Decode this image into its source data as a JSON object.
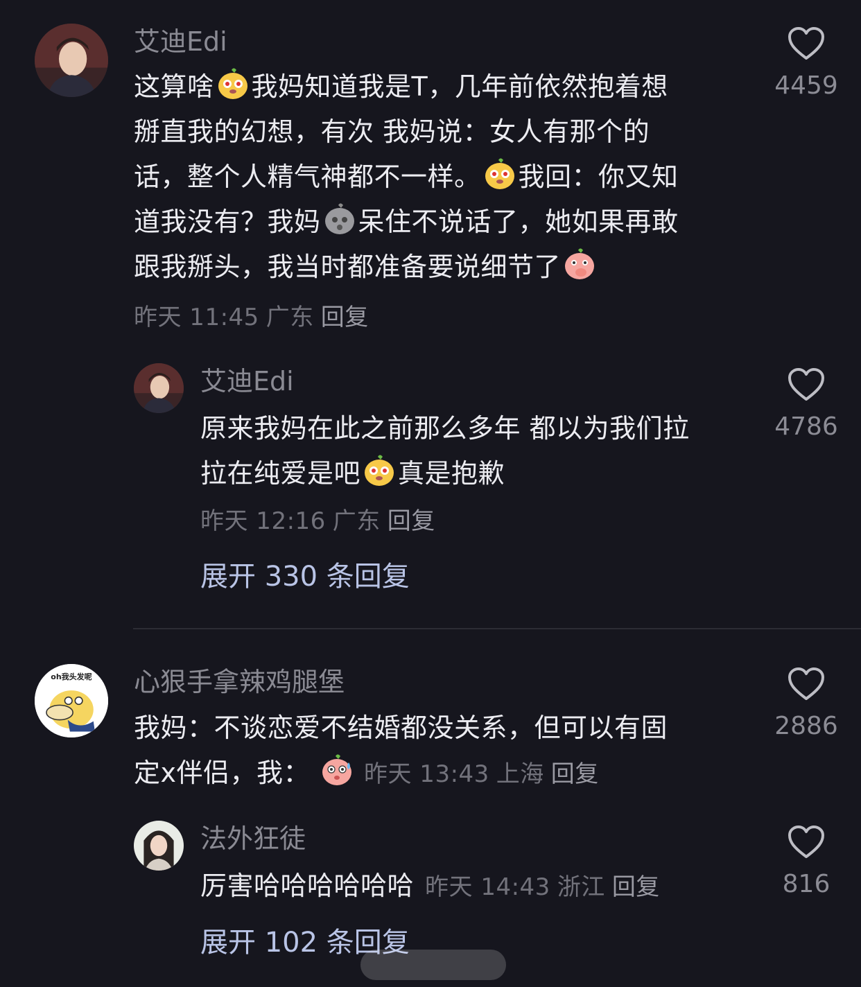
{
  "comments": [
    {
      "author": "艾迪Edi",
      "avatar_icon": "profile-photo-avatar",
      "line1_a": "这算啥",
      "line1_b": "我妈知道我是T，几年前依然抱着想",
      "line2": "掰直我的幻想，有次 我妈说：女人有那个的",
      "line3_a": "话，整个人精气神都不一样。",
      "line3_b": "我回：你又知",
      "line4_a": "道我没有？我妈",
      "line4_b": "呆住不说话了，她如果再敢",
      "line5": "跟我掰头，我当时都准备要说细节了",
      "time": "昨天 11:45",
      "location": "广东",
      "reply_label": "回复",
      "likes": "4459",
      "reply": {
        "author": "艾迪Edi",
        "line1": "原来我妈在此之前那么多年 都以为我们拉",
        "line2_a": "拉在纯爱是吧",
        "line2_b": "真是抱歉",
        "time": "昨天 12:16",
        "location": "广东",
        "reply_label": "回复",
        "likes": "4786"
      },
      "expand_label": "展开 330 条回复"
    },
    {
      "author": "心狠手拿辣鸡腿堡",
      "avatar_icon": "cartoon-duck-avatar",
      "avatar_text": "oh我头发呢",
      "line1": "我妈：不谈恋爱不结婚都没关系，但可以有固",
      "line2": "定x伴侣，我：",
      "time": "昨天 13:43",
      "location": "上海",
      "reply_label": "回复",
      "likes": "2886",
      "reply": {
        "author": "法外狂徒",
        "text": "厉害哈哈哈哈哈哈",
        "time": "昨天 14:43",
        "location": "浙江",
        "reply_label": "回复",
        "likes": "816"
      },
      "expand_label": "展开 102 条回复"
    }
  ],
  "colors": {
    "background": "#16161e",
    "expand_link": "#b9c4e6",
    "emoji_yellow": "#f7c948",
    "emoji_pink": "#f6a6a0"
  }
}
